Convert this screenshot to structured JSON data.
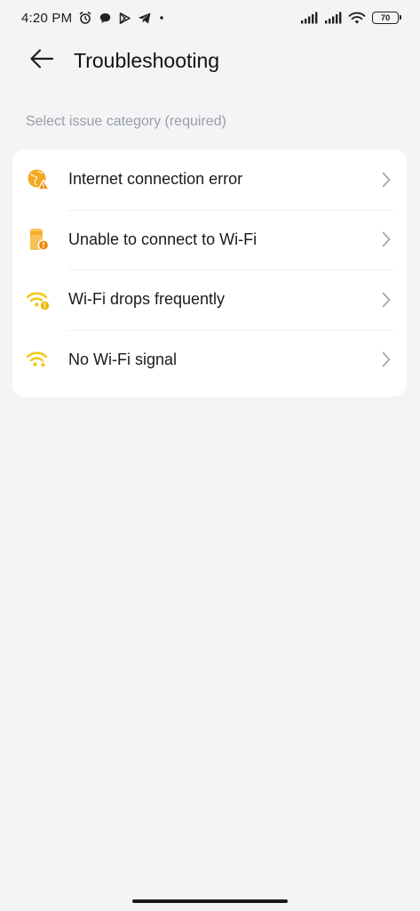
{
  "status_bar": {
    "time": "4:20 PM",
    "battery_level": "70",
    "left_icons": [
      "alarm-clock-icon",
      "chat-bubble-icon",
      "play-store-icon",
      "telegram-icon",
      "dot-icon"
    ],
    "right_icons": [
      "signal-bars-icon",
      "signal-bars-icon",
      "wifi-icon",
      "battery-icon"
    ]
  },
  "header": {
    "title": "Troubleshooting",
    "back_icon": "arrow-left-icon"
  },
  "section": {
    "label": "Select issue category (required)"
  },
  "issues": [
    {
      "label": "Internet connection error",
      "icon": "globe-warning-icon",
      "color": "#f5a623"
    },
    {
      "label": "Unable to connect to Wi-Fi",
      "icon": "router-warning-icon",
      "color": "#f5b82e"
    },
    {
      "label": "Wi-Fi drops frequently",
      "icon": "wifi-warning-icon",
      "color": "#f2c91c"
    },
    {
      "label": "No Wi-Fi signal",
      "icon": "wifi-bolt-icon",
      "color": "#f2c91c"
    }
  ],
  "colors": {
    "background": "#f3f4f6",
    "card": "#ffffff",
    "muted_text": "#9a9ea3",
    "accent_orange": "#f5a623",
    "accent_yellow": "#f2c91c"
  }
}
